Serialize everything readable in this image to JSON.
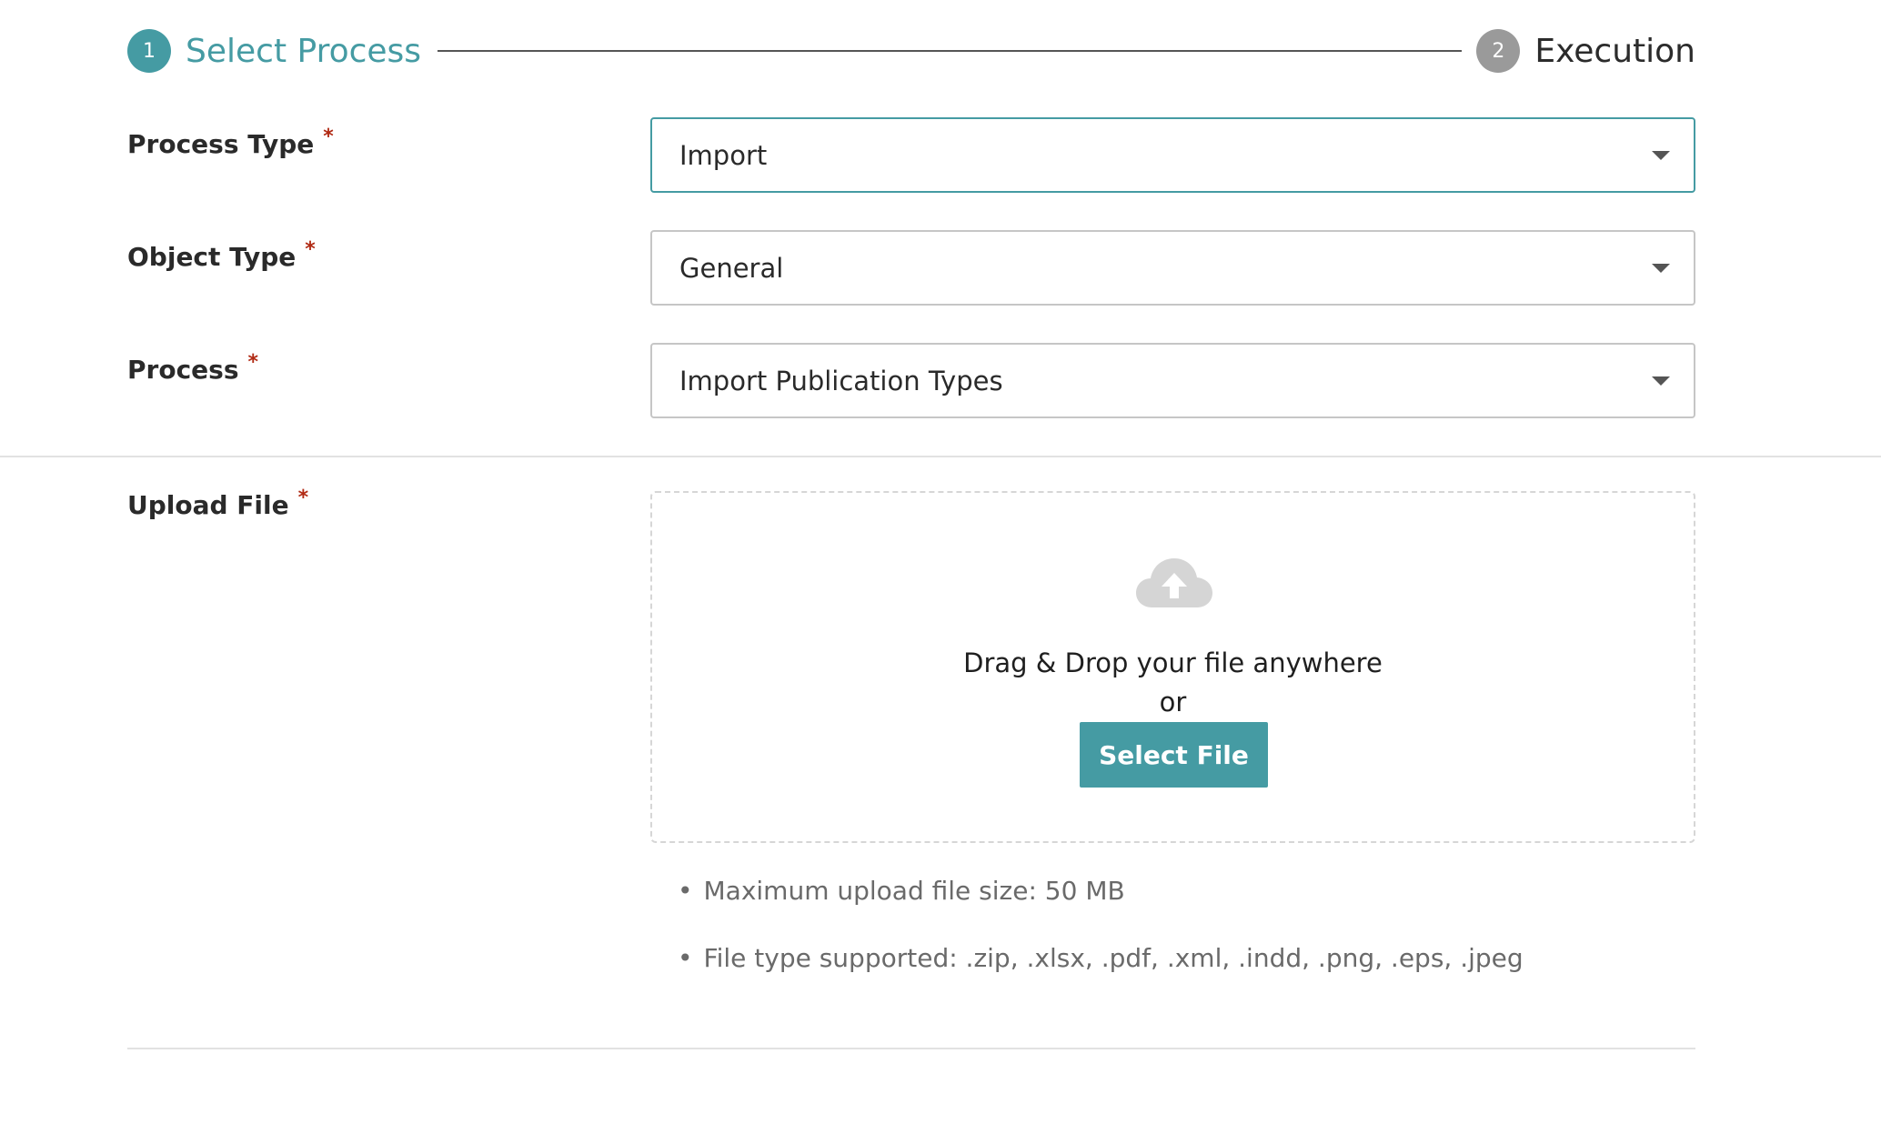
{
  "stepper": {
    "steps": [
      {
        "number": "1",
        "label": "Select Process",
        "state": "active"
      },
      {
        "number": "2",
        "label": "Execution",
        "state": "inactive"
      }
    ]
  },
  "colors": {
    "accent": "#459ba3",
    "required": "#b12a14",
    "inactive_step": "#9a9a9a"
  },
  "form": {
    "required_marker": "*",
    "process_type": {
      "label": "Process Type",
      "value": "Import"
    },
    "object_type": {
      "label": "Object Type",
      "value": "General"
    },
    "process": {
      "label": "Process",
      "value": "Import Publication Types"
    },
    "upload": {
      "label": "Upload File",
      "icon": "cloud-upload-icon",
      "drop_text": "Drag & Drop your file anywhere",
      "or_text": "or",
      "button_label": "Select File",
      "hints": [
        "Maximum upload file size: 50 MB",
        "File type supported: .zip, .xlsx, .pdf, .xml, .indd, .png, .eps, .jpeg"
      ],
      "bullet": "•"
    }
  }
}
